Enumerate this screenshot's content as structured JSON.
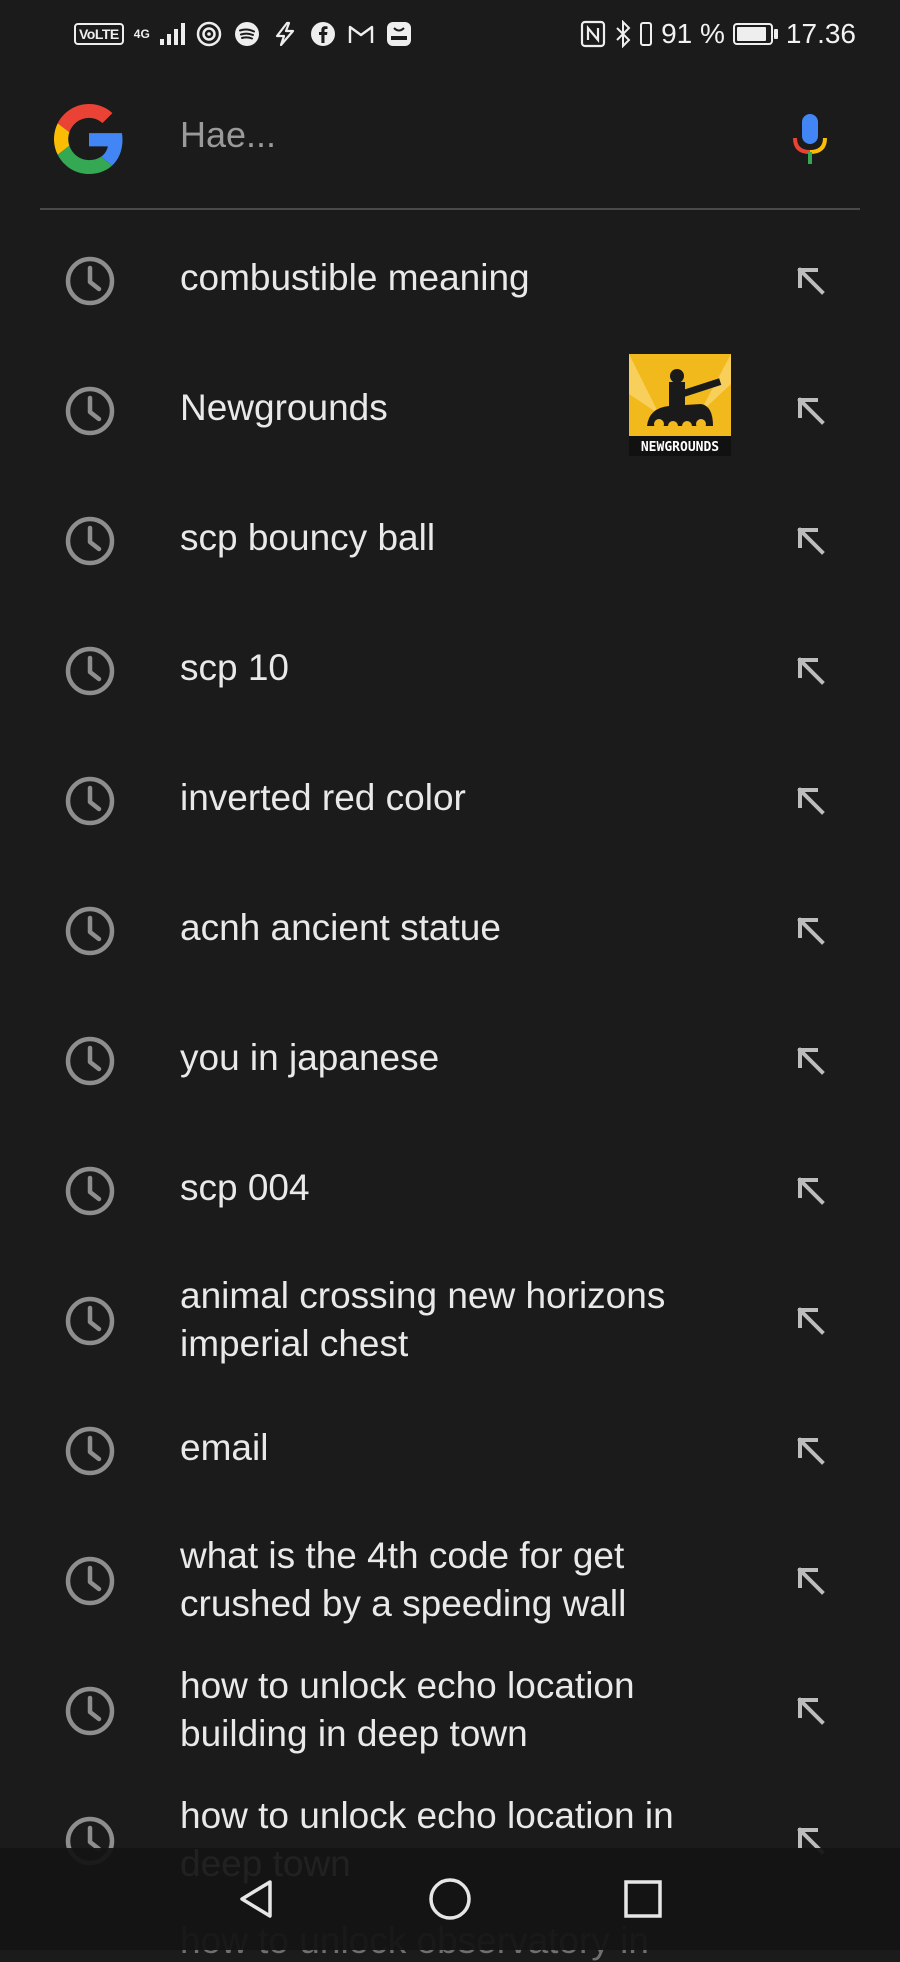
{
  "status_bar": {
    "left": {
      "volte": "VoLTE",
      "network": "4G"
    },
    "battery_percent": "91 %",
    "battery_level": 0.91,
    "time": "17.36"
  },
  "search": {
    "placeholder": "Hae...",
    "logo_icon": "google-logo-icon",
    "mic_icon": "microphone-icon"
  },
  "suggestions": [
    {
      "text": "combustible meaning"
    },
    {
      "text": "Newgrounds",
      "thumbnail_text": "NEWGROUNDS"
    },
    {
      "text": "scp bouncy ball"
    },
    {
      "text": "scp 10"
    },
    {
      "text": "inverted red color"
    },
    {
      "text": "acnh ancient statue"
    },
    {
      "text": "you in japanese"
    },
    {
      "text": "scp 004"
    },
    {
      "text": "animal crossing new horizons imperial chest"
    },
    {
      "text": "email"
    },
    {
      "text": "what is the 4th code for get crushed by a speeding wall"
    },
    {
      "text": "how to unlock echo location building in deep town"
    },
    {
      "text": "how to unlock echo location in deep town"
    },
    {
      "text": "how to unlock observatory in"
    }
  ],
  "navigation": {
    "back_icon": "back-icon",
    "home_icon": "home-icon",
    "recents_icon": "recents-icon"
  },
  "colors": {
    "background": "#1b1b1c",
    "text": "#e9e9e9",
    "icon": "#8e8e8e",
    "thumbnail_bg": "#f2b91d"
  }
}
